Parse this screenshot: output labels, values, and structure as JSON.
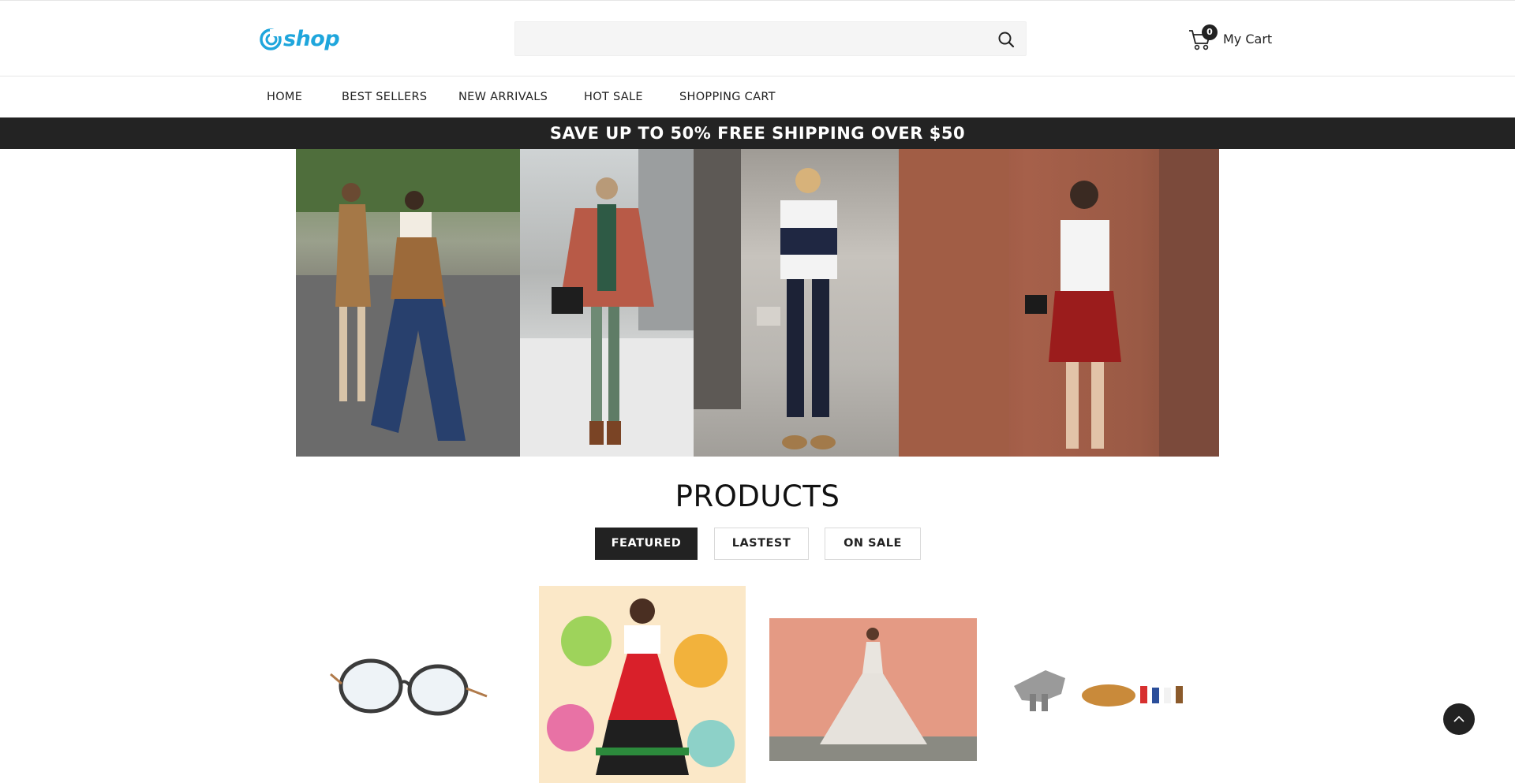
{
  "header": {
    "logo_text": "shop",
    "search": {
      "value": "",
      "placeholder": ""
    },
    "cart": {
      "count": "0",
      "label": "My Cart"
    }
  },
  "nav": {
    "items": [
      {
        "label": "HOME"
      },
      {
        "label": "BEST SELLERS"
      },
      {
        "label": "NEW ARRIVALS"
      },
      {
        "label": "HOT SALE"
      },
      {
        "label": "SHOPPING CART"
      }
    ]
  },
  "promo": {
    "text": "SAVE UP TO 50% FREE SHIPPING OVER $50"
  },
  "products": {
    "title": "PRODUCTS",
    "tabs": [
      {
        "label": "FEATURED",
        "active": true
      },
      {
        "label": "LASTEST",
        "active": false
      },
      {
        "label": "ON SALE",
        "active": false
      }
    ]
  },
  "colors": {
    "brand": "#1fa6dc",
    "dark": "#222222",
    "promo_bg": "#232323"
  },
  "icons": [
    "search-icon",
    "cart-icon",
    "chevron-up-icon"
  ]
}
